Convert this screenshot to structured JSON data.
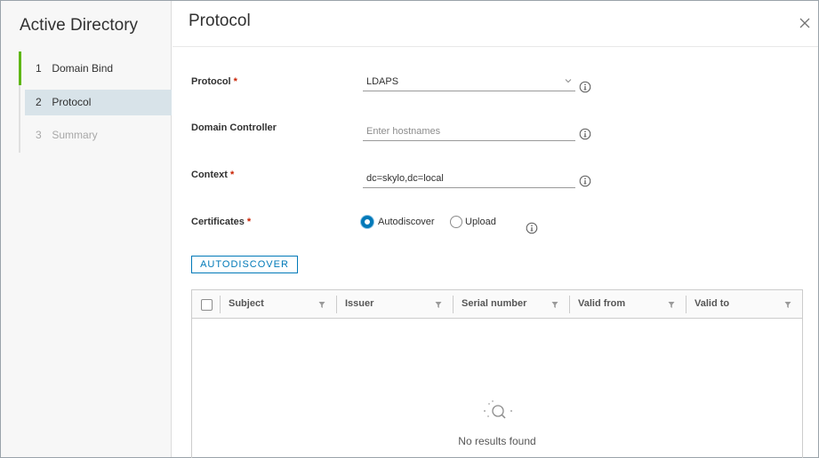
{
  "sidebar": {
    "title": "Active Directory",
    "steps": [
      {
        "num": "1",
        "label": "Domain Bind",
        "state": "done"
      },
      {
        "num": "2",
        "label": "Protocol",
        "state": "active"
      },
      {
        "num": "3",
        "label": "Summary",
        "state": "pending"
      }
    ]
  },
  "header": {
    "title": "Protocol"
  },
  "form": {
    "protocol": {
      "label": "Protocol",
      "required": "*",
      "value": "LDAPS"
    },
    "domain_controller": {
      "label": "Domain Controller",
      "placeholder": "Enter hostnames"
    },
    "context": {
      "label": "Context",
      "required": "*",
      "value": "dc=skylo,dc=local"
    },
    "certificates": {
      "label": "Certificates",
      "required": "*",
      "options": [
        "Autodiscover",
        "Upload"
      ],
      "selected": "Autodiscover"
    },
    "autodiscover_button": "AUTODISCOVER"
  },
  "grid": {
    "columns": [
      "Subject",
      "Issuer",
      "Serial number",
      "Valid from",
      "Valid to"
    ],
    "empty_text": "No results found"
  },
  "colors": {
    "accent": "#0079b8",
    "done_step": "#5eb715",
    "required": "#c92100",
    "active_step_bg": "#d8e3e9"
  },
  "icons": [
    "close-icon",
    "chevron-down-icon",
    "info-icon",
    "filter-icon",
    "search-empty-icon"
  ]
}
